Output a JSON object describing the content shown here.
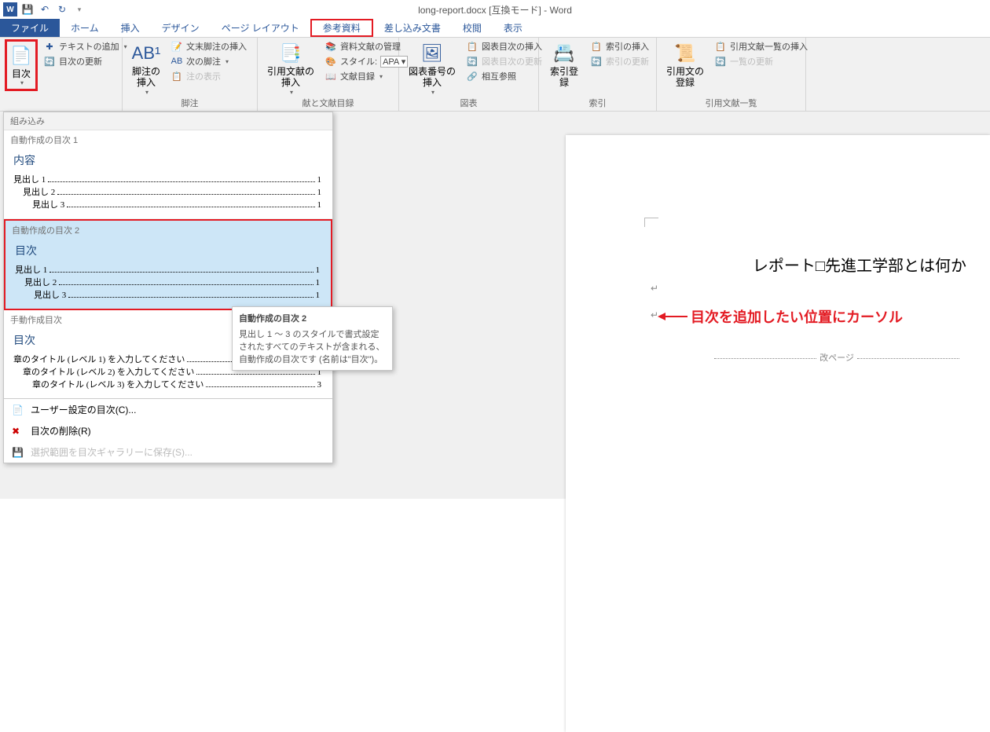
{
  "window_title": "long-report.docx [互換モード] - Word",
  "tabs": {
    "file": "ファイル",
    "home": "ホーム",
    "insert": "挿入",
    "design": "デザイン",
    "layout": "ページ レイアウト",
    "references": "参考資料",
    "mailings": "差し込み文書",
    "review": "校閲",
    "view": "表示"
  },
  "ribbon": {
    "toc_btn": "目次",
    "add_text": "テキストの追加",
    "update_toc": "目次の更新",
    "footnote_big": "脚注の\n挿入",
    "insert_endnote": "文末脚注の挿入",
    "next_footnote": "次の脚注",
    "show_notes": "注の表示",
    "insert_citation": "引用文献の\n挿入",
    "manage_sources": "資料文献の管理",
    "style": "スタイル:",
    "style_value": "APA",
    "bibliography": "文献目録",
    "insert_caption": "図表番号の\n挿入",
    "insert_tof": "図表目次の挿入",
    "update_tof": "図表目次の更新",
    "cross_ref": "相互参照",
    "mark_entry": "索引登録",
    "insert_index": "索引の挿入",
    "update_index": "索引の更新",
    "mark_citation": "引用文の\n登録",
    "insert_toa": "引用文献一覧の挿入",
    "update_toa": "一覧の更新",
    "grp_footnotes": "脚注",
    "grp_citations_partial": "献と文献目録",
    "grp_captions": "図表",
    "grp_index": "索引",
    "grp_toa": "引用文献一覧"
  },
  "gallery": {
    "builtin": "組み込み",
    "auto1_title": "自動作成の目次 1",
    "auto2_title": "自動作成の目次 2",
    "manual_title": "手動作成目次",
    "contents_head": "内容",
    "toc_head": "目次",
    "h1": "見出し 1",
    "h2": "見出し 2",
    "h3": "見出し 3",
    "page1": "1",
    "page3": "3",
    "m1": "章のタイトル (レベル 1) を入力してください",
    "m2": "章のタイトル (レベル 2) を入力してください",
    "m3": "章のタイトル (レベル 3) を入力してください",
    "custom": "ユーザー設定の目次(C)...",
    "remove": "目次の削除(R)",
    "save_sel": "選択範囲を目次ギャラリーに保存(S)..."
  },
  "tooltip": {
    "title": "自動作成の目次 2",
    "body": "見出し 1 ～ 3 のスタイルで書式設定されたすべてのテキストが含まれる、自動作成の目次です (名前は\"目次\")。"
  },
  "doc": {
    "title": "レポート□先進工学部とは何か",
    "pagebreak": "改ページ"
  },
  "annotation": "目次を追加したい位置にカーソル"
}
